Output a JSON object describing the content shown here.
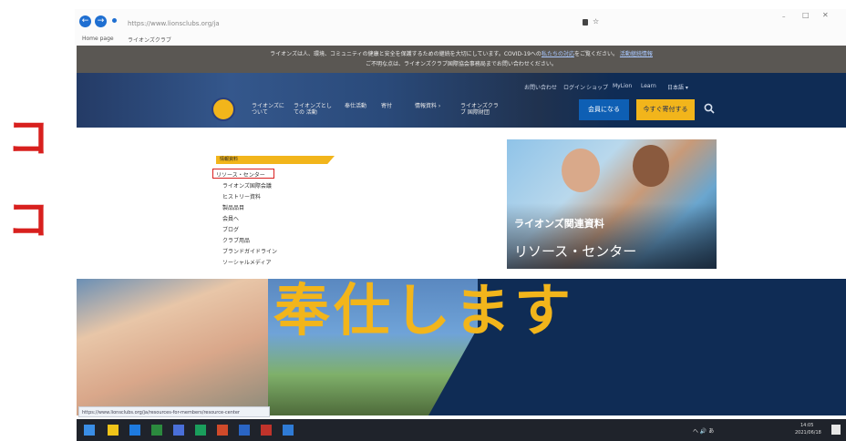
{
  "annotation": {
    "char_top": "コ",
    "char_bottom": "コ",
    "color": "#d8201e"
  },
  "browser": {
    "back_glyph": "←",
    "forward_glyph": "→",
    "address": "https://www.lionsclubs.org/ja",
    "bookmarks": [
      "Home page",
      "ライオンズクラブ"
    ],
    "icons": [
      "back-icon",
      "forward-icon",
      "lock-icon",
      "refresh-icon",
      "star-icon",
      "minimize-icon",
      "maximize-icon",
      "close-icon"
    ]
  },
  "notice": {
    "line1_a": "ライオンズは人、環境、コミュニティの健康と安全を保護するための継続を大切にしています。COVID-19への",
    "line1_link": "私たちの対応",
    "line1_b": "をご覧ください。",
    "line1_link2": "活動継続情報",
    "line2": "ご不明な点は、ライオンズクラブ国際協会事務局までお問い合わせください。"
  },
  "header": {
    "nav": [
      "ライオンズに ついて",
      "ライオンズとしての 活動",
      "奉仕活動",
      "寄付",
      "情報資料 ›",
      "ライオンズクラブ 国際財団"
    ],
    "utility": [
      "お問い合わせ",
      "ログイン",
      "ショップ",
      "MyLion",
      "Learn",
      "日本語 ▾"
    ],
    "join_label": "会員になる",
    "donate_label": "今すぐ寄付する",
    "brand_color": "#f2b51b",
    "navy": "#0f2c55"
  },
  "menu": {
    "category": "情報資料",
    "items": [
      "リソース・センター",
      "ライオンズ国際会議",
      "ヒストリー資料",
      "製品品目",
      "会員へ",
      "ブログ",
      "クラブ用品",
      "ブランドガイドライン",
      "ソーシャルメディア"
    ],
    "highlighted_index": 0,
    "feature_tag": "ライオンズ関連資料",
    "feature_title": "リソース・センター"
  },
  "hero": {
    "text": "奉仕します"
  },
  "status_url": "https://www.lionsclubs.org/ja/resources-for-members/resource-center",
  "taskbar": {
    "tray_text": "へ 🔊 あ",
    "time": "14:05",
    "date": "2021/06/18"
  }
}
